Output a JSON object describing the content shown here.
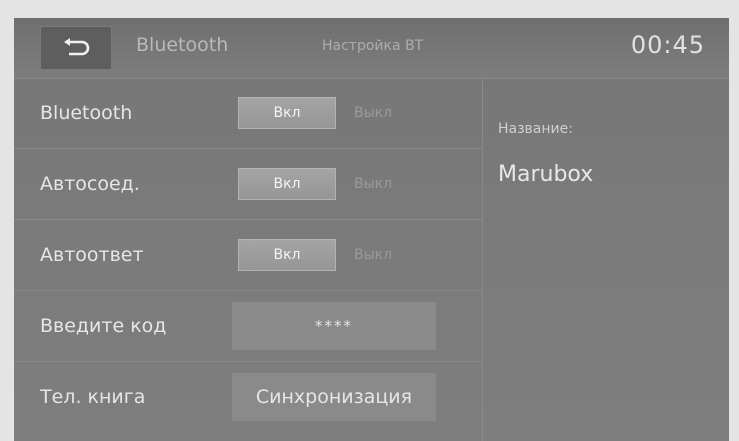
{
  "header": {
    "title": "Bluetooth",
    "subtitle": "Настройка ВТ",
    "clock": "00:45"
  },
  "settings": [
    {
      "label": "Bluetooth",
      "on_label": "Вкл",
      "off_label": "Выкл",
      "state": "on"
    },
    {
      "label": "Автосоед.",
      "on_label": "Вкл",
      "off_label": "Выкл",
      "state": "on"
    },
    {
      "label": "Автоответ",
      "on_label": "Вкл",
      "off_label": "Выкл",
      "state": "on"
    }
  ],
  "pin": {
    "label": "Введите код",
    "value": "****"
  },
  "phonebook": {
    "label": "Тел. книга",
    "button_label": "Синхронизация"
  },
  "device": {
    "name_label": "Название:",
    "name_value": "Marubox"
  },
  "icons": {
    "back": "back-arrow-icon"
  }
}
